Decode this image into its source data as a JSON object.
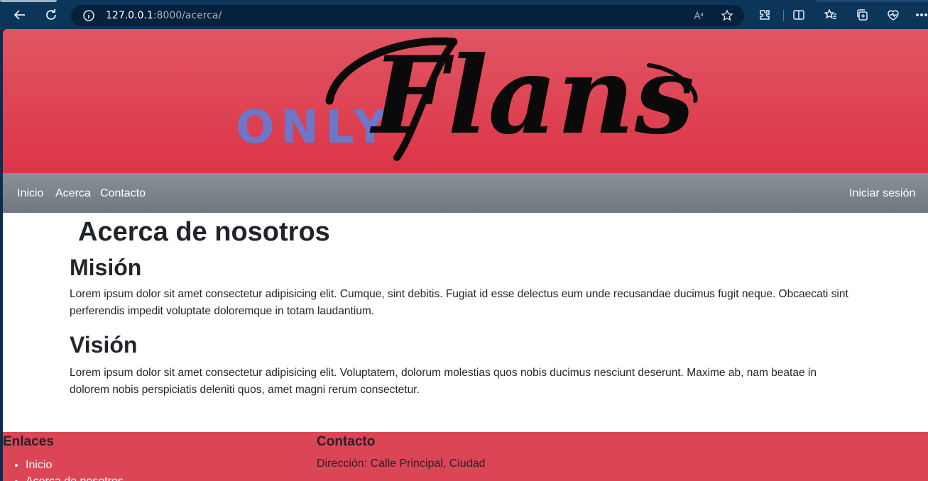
{
  "browser": {
    "url_host": "127.0.0.1",
    "url_path": ":8000/acerca/",
    "icons": [
      "back-icon",
      "refresh-icon",
      "info-icon",
      "read-aloud-icon",
      "favorite-star-icon",
      "extensions-icon",
      "split-screen-icon",
      "favorites-icon",
      "collections-icon",
      "performance-icon",
      "more-icon"
    ]
  },
  "header": {
    "logo_only": "ONLY",
    "logo_flans": "Flans",
    "accent_color": "#db3547",
    "logo_blue": "#6d77c9"
  },
  "navbar": {
    "links": [
      "Inicio",
      "Acerca",
      "Contacto"
    ],
    "login": "Iniciar sesión"
  },
  "main": {
    "title": "Acerca de nosotros",
    "mission_heading": "Misión",
    "mission_text": "Lorem ipsum dolor sit amet consectetur adipisicing elit. Cumque, sint debitis. Fugiat id esse delectus eum unde recusandae ducimus fugit neque. Obcaecati sint perferendis impedit voluptate doloremque in totam laudantium.",
    "vision_heading": "Visión",
    "vision_text": "Lorem ipsum dolor sit amet consectetur adipisicing elit. Voluptatem, dolorum molestias quos nobis ducimus nesciunt deserunt. Maxime ab, nam beatae in dolorem nobis perspiciatis deleniti quos, amet magni rerum consectetur."
  },
  "footer": {
    "links_heading": "Enlaces",
    "links": [
      "Inicio",
      "Acerca de nosotros"
    ],
    "contact_heading": "Contacto",
    "address": "Dirección: Calle Principal, Ciudad"
  }
}
